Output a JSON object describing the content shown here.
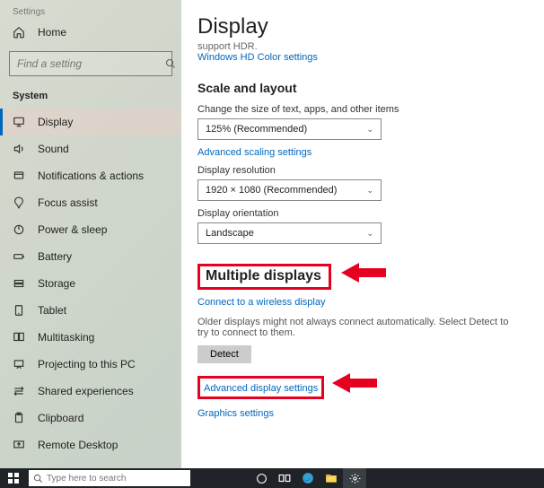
{
  "app": {
    "title": "Settings"
  },
  "home": {
    "label": "Home"
  },
  "search": {
    "placeholder": "Find a setting"
  },
  "section": {
    "label": "System"
  },
  "nav": [
    {
      "label": "Display",
      "active": true
    },
    {
      "label": "Sound"
    },
    {
      "label": "Notifications & actions"
    },
    {
      "label": "Focus assist"
    },
    {
      "label": "Power & sleep"
    },
    {
      "label": "Battery"
    },
    {
      "label": "Storage"
    },
    {
      "label": "Tablet"
    },
    {
      "label": "Multitasking"
    },
    {
      "label": "Projecting to this PC"
    },
    {
      "label": "Shared experiences"
    },
    {
      "label": "Clipboard"
    },
    {
      "label": "Remote Desktop"
    }
  ],
  "page": {
    "title": "Display",
    "hdr_note": "support HDR.",
    "hdr_link": "Windows HD Color settings",
    "scale_heading": "Scale and layout",
    "scale_label": "Change the size of text, apps, and other items",
    "scale_value": "125% (Recommended)",
    "adv_scaling_link": "Advanced scaling settings",
    "res_label": "Display resolution",
    "res_value": "1920 × 1080 (Recommended)",
    "orient_label": "Display orientation",
    "orient_value": "Landscape",
    "multi_heading": "Multiple displays",
    "wireless_link": "Connect to a wireless display",
    "older_para": "Older displays might not always connect automatically. Select Detect to try to connect to them.",
    "detect_btn": "Detect",
    "adv_display_link": "Advanced display settings",
    "graphics_link": "Graphics settings"
  },
  "taskbar": {
    "search_placeholder": "Type here to search"
  }
}
